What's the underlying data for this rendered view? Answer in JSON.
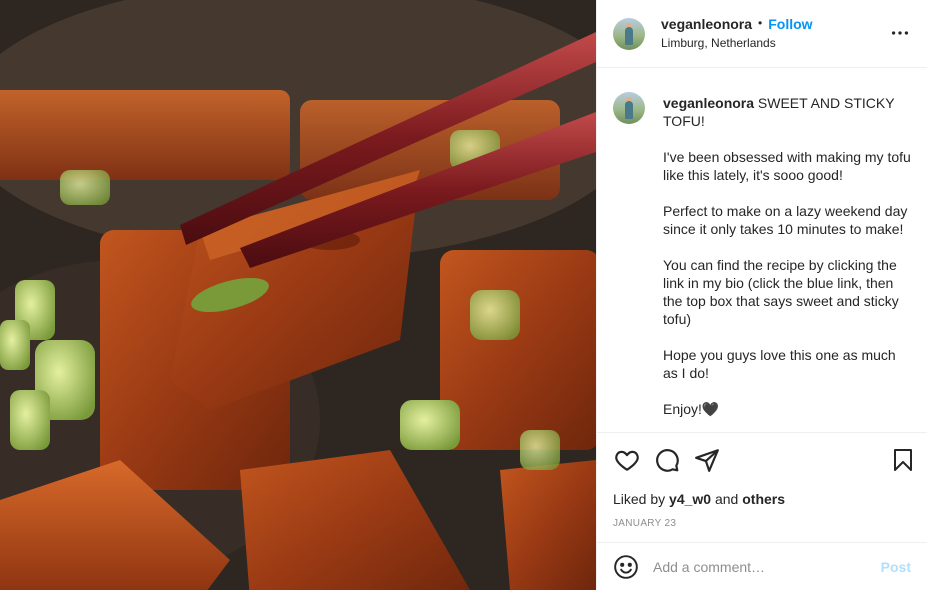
{
  "post": {
    "image_alt": "Sweet and sticky tofu held with chopsticks",
    "header": {
      "username": "veganleonora",
      "separator": "•",
      "follow_label": "Follow",
      "location": "Limburg, Netherlands",
      "more_icon": "more-horizontal-icon"
    },
    "caption": {
      "username": "veganleonora",
      "title_text": " SWEET AND STICKY TOFU!",
      "paragraphs": [
        "I've been obsessed with making my tofu like this lately, it's sooo good!",
        "Perfect to make on a lazy weekend day since it only takes 10 minutes to make!",
        "You can find the recipe by clicking the link in my bio (click the blue link, then the top box that says sweet and sticky tofu)",
        "Hope you guys love this one as much as I do!",
        "Enjoy!🖤"
      ]
    },
    "actions": {
      "like_icon": "heart-icon",
      "comment_icon": "comment-icon",
      "share_icon": "share-icon",
      "save_icon": "bookmark-icon"
    },
    "likes": {
      "prefix": "Liked by ",
      "user": "y4_w0",
      "middle": " and ",
      "others": "others"
    },
    "date": "JANUARY 23",
    "comment_box": {
      "emoji_icon": "smiley-icon",
      "placeholder": "Add a comment…",
      "post_label": "Post"
    }
  },
  "colors": {
    "accent": "#0095f6",
    "post_disabled": "#b2dffc",
    "text": "#262626",
    "muted": "#8e8e8e"
  }
}
